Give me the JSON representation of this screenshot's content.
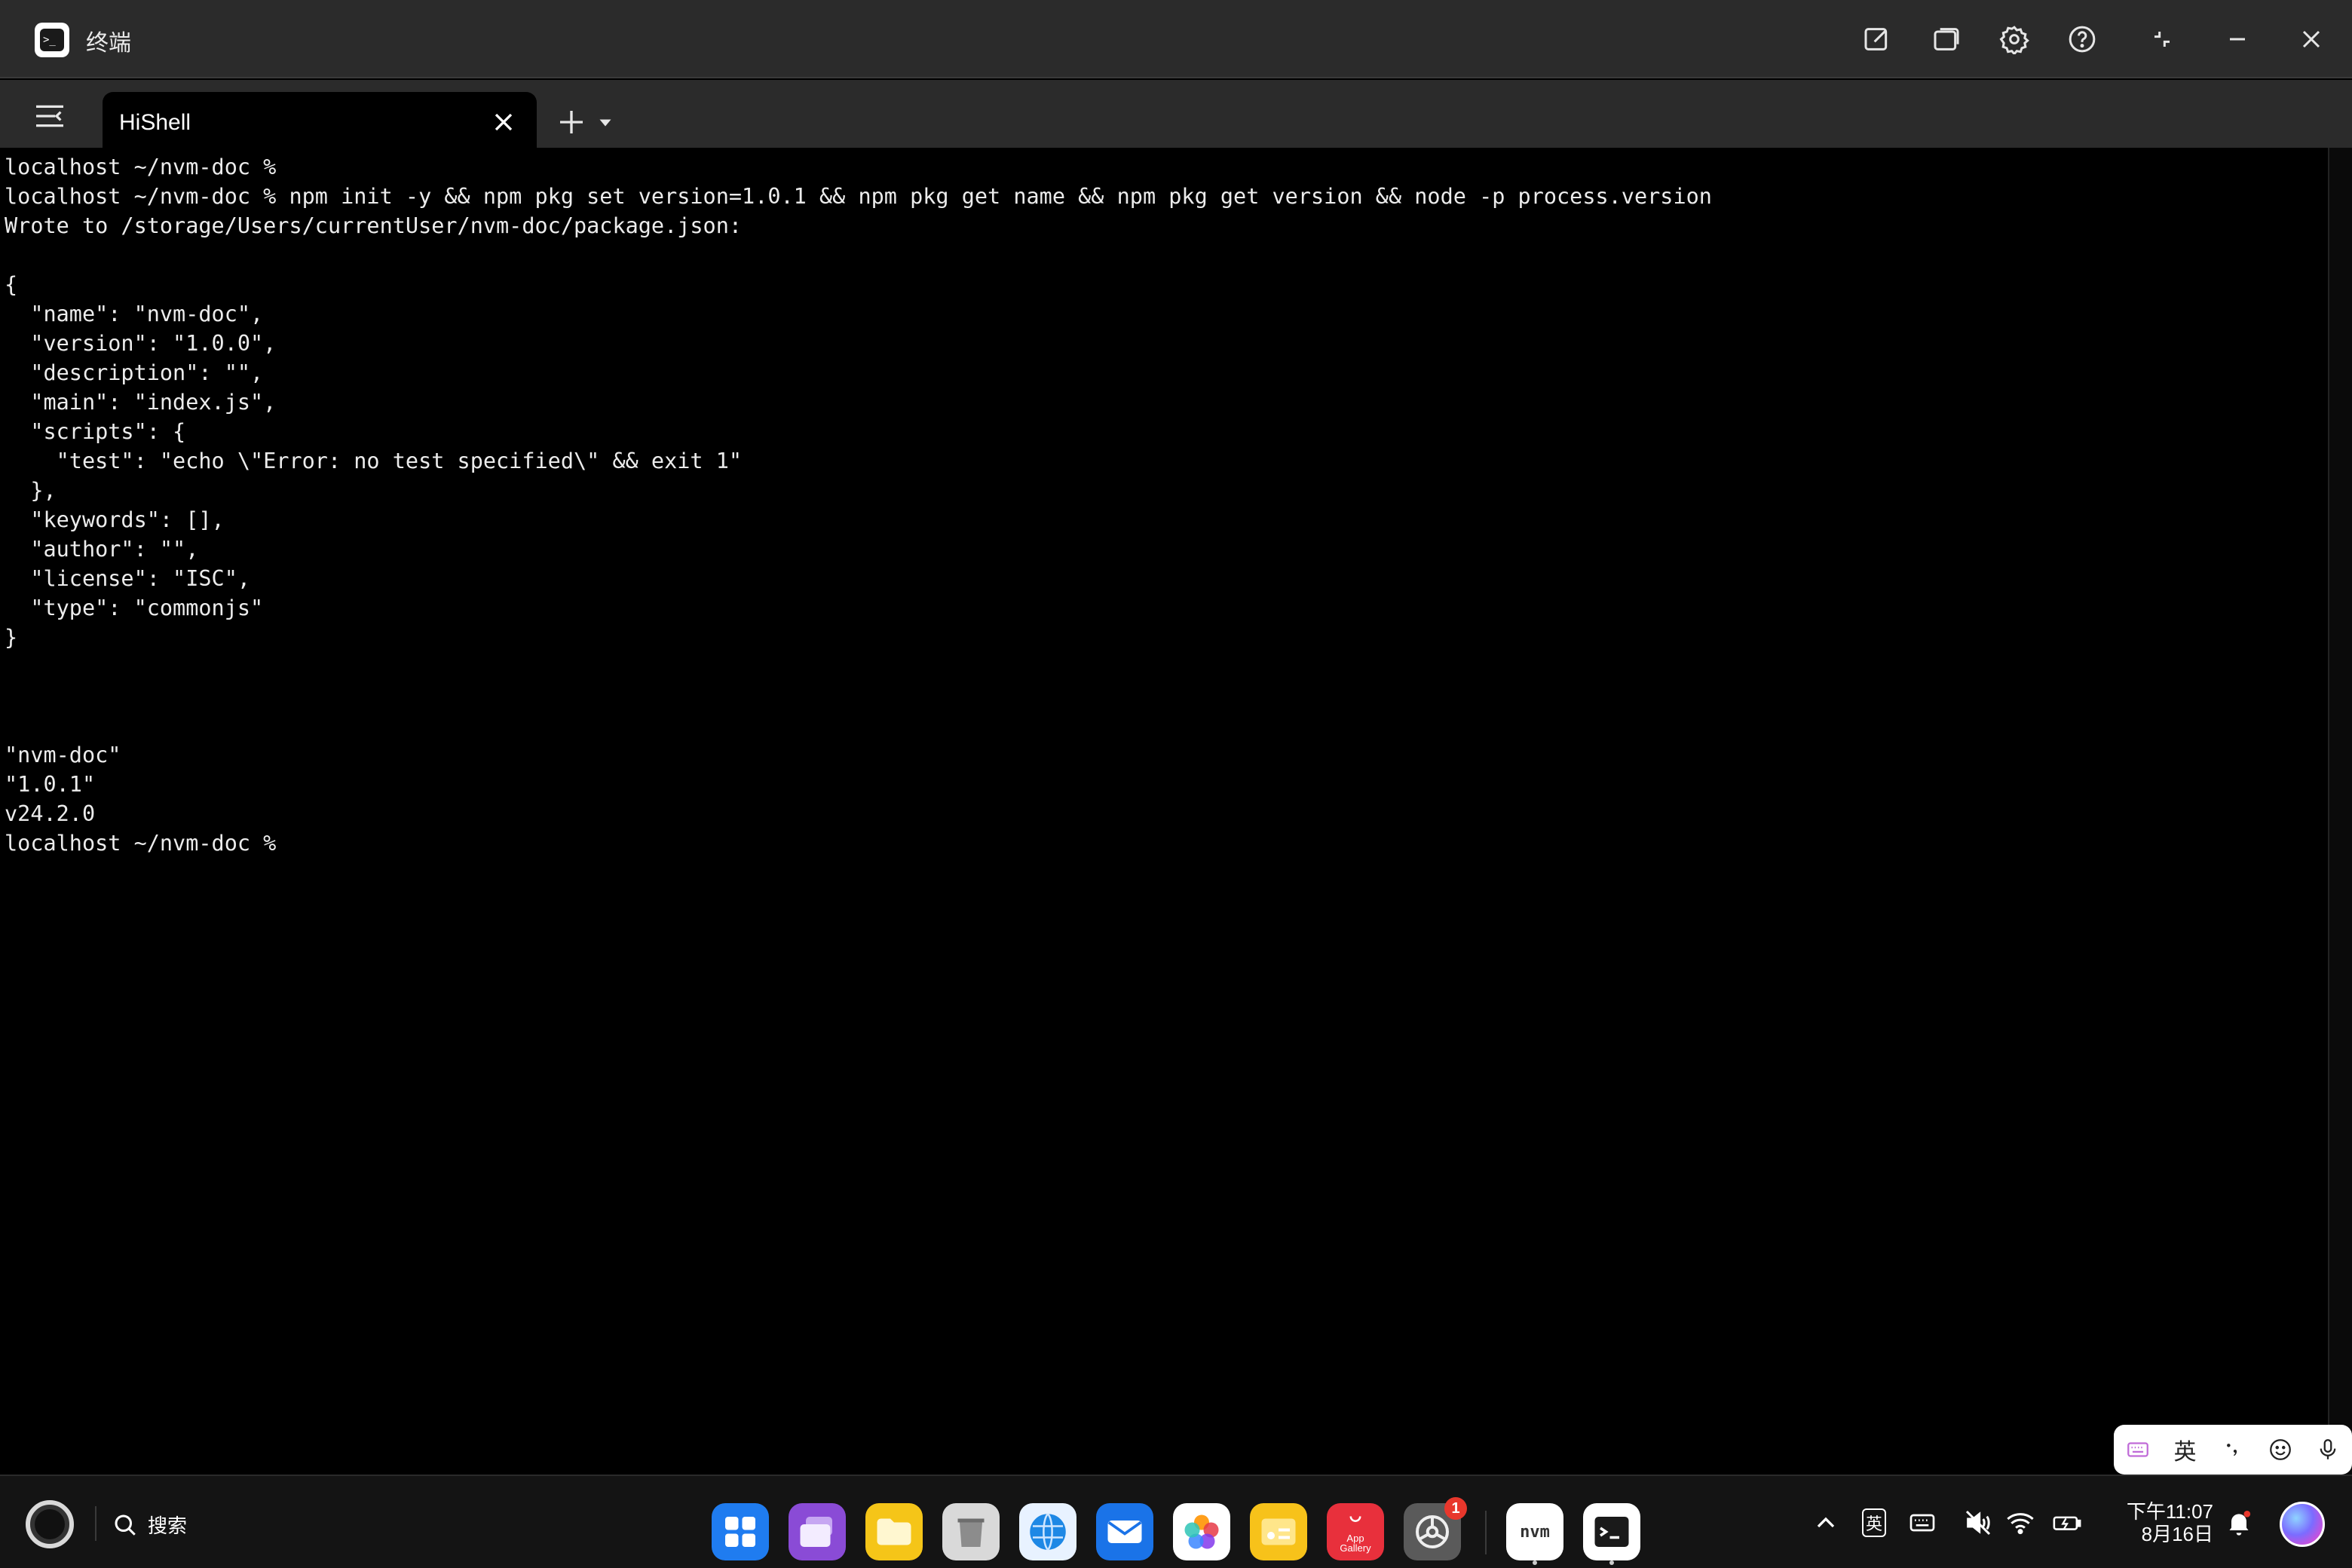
{
  "window": {
    "title": "终端"
  },
  "tabs": [
    {
      "label": "HiShell"
    }
  ],
  "terminal": {
    "lines": [
      "localhost ~/nvm-doc %",
      "localhost ~/nvm-doc % npm init -y && npm pkg set version=1.0.1 && npm pkg get name && npm pkg get version && node -p process.version",
      "Wrote to /storage/Users/currentUser/nvm-doc/package.json:",
      "",
      "{",
      "  \"name\": \"nvm-doc\",",
      "  \"version\": \"1.0.0\",",
      "  \"description\": \"\",",
      "  \"main\": \"index.js\",",
      "  \"scripts\": {",
      "    \"test\": \"echo \\\"Error: no test specified\\\" && exit 1\"",
      "  },",
      "  \"keywords\": [],",
      "  \"author\": \"\",",
      "  \"license\": \"ISC\",",
      "  \"type\": \"commonjs\"",
      "}",
      "",
      "",
      "",
      "\"nvm-doc\"",
      "\"1.0.1\"",
      "v24.2.0",
      "localhost ~/nvm-doc %"
    ]
  },
  "ime": {
    "lang": "英"
  },
  "dock": {
    "search_label": "搜索",
    "app_gallery_label": "App Gallery",
    "settings_badge": "1",
    "nvm_label": "nvm"
  },
  "tray": {
    "ime_label": "英"
  },
  "clock": {
    "time": "下午11:07",
    "date": "8月16日"
  },
  "colors": {
    "titlebar": "#2b2b2b",
    "terminal_bg": "#000000",
    "dock_bg": "#141414",
    "badge": "#e8372c"
  }
}
